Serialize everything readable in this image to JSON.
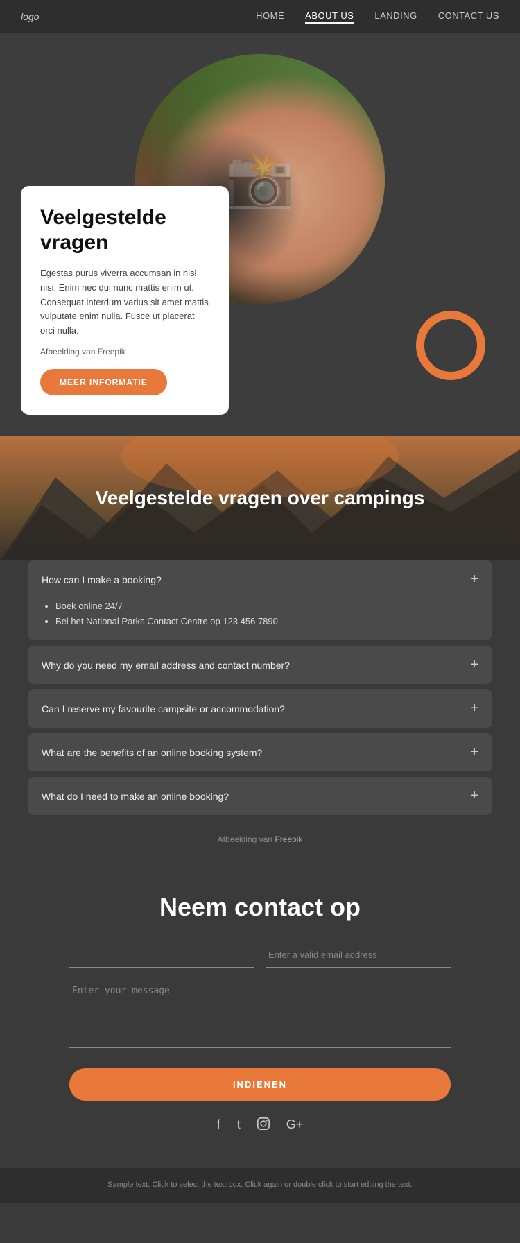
{
  "navbar": {
    "logo": "logo",
    "links": [
      {
        "label": "HOME",
        "active": false
      },
      {
        "label": "ABOUT US",
        "active": true
      },
      {
        "label": "LANDING",
        "active": false
      },
      {
        "label": "CONTACT US",
        "active": false
      }
    ]
  },
  "hero": {
    "title": "Veelgestelde\nvragen",
    "body": "Egestas purus viverra accumsan in nisl nisi. Enim nec dui nunc mattis enim ut. Consequat interdum varius sit amet mattis vulputate enim nulla. Fusce ut placerat orci nulla.",
    "freepik_text": "Afbeelding van",
    "freepik_link": "Freepik",
    "button_label": "MEER INFORMATIE"
  },
  "faq_banner": {
    "title": "Veelgestelde vragen over campings"
  },
  "accordion": {
    "items": [
      {
        "question": "How can I make a booking?",
        "open": true,
        "answer_items": [
          "Boek online 24/7",
          "Bel het National Parks Contact Centre op 123 456 7890"
        ]
      },
      {
        "question": "Why do you need my email address and contact number?",
        "open": false
      },
      {
        "question": "Can I reserve my favourite campsite or accommodation?",
        "open": false
      },
      {
        "question": "What are the benefits of an online booking system?",
        "open": false
      },
      {
        "question": "What do I need to make an online booking?",
        "open": false
      }
    ],
    "freepik_text": "Afbeelding van",
    "freepik_link": "Freepik"
  },
  "contact": {
    "title": "Neem contact op",
    "name_placeholder": "",
    "email_placeholder": "Enter a valid email address",
    "message_placeholder": "Enter your message",
    "submit_label": "INDIENEN"
  },
  "social": {
    "icons": [
      "f",
      "t",
      "ig",
      "g+"
    ]
  },
  "footer": {
    "text": "Sample text. Click to select the text box. Click again or double click to start editing the text."
  }
}
